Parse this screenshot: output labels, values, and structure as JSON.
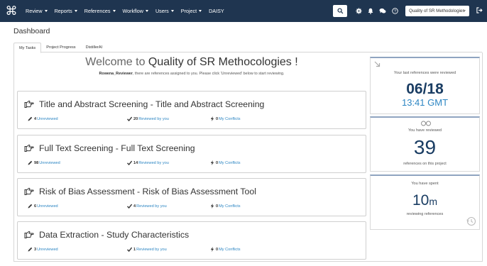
{
  "nav": {
    "logo_glyph": "⌘",
    "menus": [
      {
        "label": "Review",
        "has_dropdown": true
      },
      {
        "label": "Reports",
        "has_dropdown": true
      },
      {
        "label": "References",
        "has_dropdown": true
      },
      {
        "label": "Workflow",
        "has_dropdown": true
      },
      {
        "label": "Users",
        "has_dropdown": true
      },
      {
        "label": "Project",
        "has_dropdown": true
      },
      {
        "label": "DAISY",
        "has_dropdown": false
      }
    ],
    "project_select": "Quality of SR Methodologies",
    "icons": [
      "search-icon",
      "gear-icon",
      "bell-icon",
      "chat-icon",
      "help-icon",
      "sign-out-icon"
    ]
  },
  "page": {
    "title": "Dashboard"
  },
  "tabs": [
    {
      "label": "My Tasks",
      "active": true
    },
    {
      "label": "Project Progress",
      "active": false
    },
    {
      "label": "DistillerAI",
      "active": false
    }
  ],
  "welcome": {
    "prefix": "Welcome to ",
    "project": "Quality of SR Methocologies !",
    "user": "Rowena_Reviewer",
    "message": ", there are references assigned to you. Please click 'Unreviewed' below to start reviewing."
  },
  "tasks": [
    {
      "title": "Title and Abstract Screening - Title and Abstract Screening",
      "unreviewed": "4",
      "reviewed": "20",
      "conflicts": "0"
    },
    {
      "title": "Full Text Screening - Full Text Screening",
      "unreviewed": "98",
      "reviewed": "14",
      "conflicts": "0"
    },
    {
      "title": "Risk of Bias Assessment - Risk of Bias Assessment Tool",
      "unreviewed": "6",
      "reviewed": "4",
      "conflicts": "0"
    },
    {
      "title": "Data Extraction - Study Characteristics",
      "unreviewed": "3",
      "reviewed": "1",
      "conflicts": "0"
    }
  ],
  "task_labels": {
    "unreviewed": "Unreviewed",
    "reviewed": "Reviewed by you",
    "conflicts": "My Conflicts"
  },
  "sidebar": {
    "last_reviewed": {
      "caption": "Your last references were reviewed",
      "date": "06/18",
      "time": "13:41 GMT"
    },
    "reviewed": {
      "caption": "You have reviewed",
      "count": "39",
      "footer": "references on this project"
    },
    "spent": {
      "caption": "You have spent",
      "value": "10",
      "unit": "m",
      "footer": "reviewing references"
    }
  },
  "colors": {
    "navbar": "#1f3550",
    "link": "#2d86c3",
    "big_number": "#1a3d63"
  }
}
